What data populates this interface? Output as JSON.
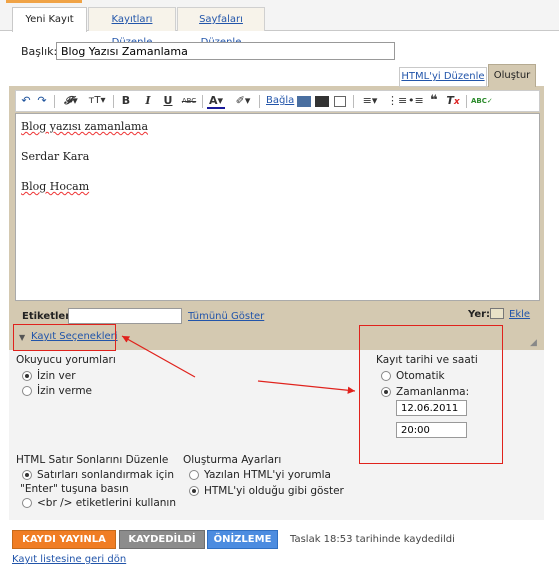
{
  "tabs": [
    "Yeni Kayıt",
    "Kayıtları Düzenle",
    "Sayfaları Düzenle"
  ],
  "title": {
    "label": "Başlık:",
    "value": "Blog Yazısı Zamanlama"
  },
  "editor_tabs": {
    "html": "HTML'yi Düzenle",
    "compose": "Oluştur"
  },
  "toolbar": {
    "link_label": "Bağla",
    "undo_icon": "undo-icon",
    "redo_icon": "redo-icon"
  },
  "body_lines": [
    "Blog yazısı zamanlama",
    "Serdar Kara",
    "Blog Hocam"
  ],
  "labels": {
    "label": "Etiketler:",
    "show_all": "Tümünü Göster"
  },
  "location": {
    "label": "Yer:",
    "add": "Ekle"
  },
  "options_link": "Kayıt Seçenekleri",
  "reader_comments": {
    "heading": "Okuyucu yorumları",
    "allow": "İzin ver",
    "deny": "İzin verme"
  },
  "post_date": {
    "heading": "Kayıt tarihi ve saati",
    "automatic": "Otomatik",
    "scheduled": "Zamanlanma:",
    "date": "12.06.2011",
    "time": "20:00"
  },
  "line_breaks": {
    "heading": "HTML Satır Sonlarını Düzenle",
    "option1_line1": "Satırları sonlandırmak için",
    "option1_line2": "\"Enter\" tuşuna basın",
    "option2": "<br /> etiketlerini kullanın"
  },
  "compose": {
    "heading": "Oluşturma Ayarları",
    "interpret": "Yazılan HTML'yi yorumla",
    "show_as_is": "HTML'yi olduğu gibi göster"
  },
  "actions": {
    "publish": "KAYDI YAYINLA",
    "saved": "KAYDEDİLDİ",
    "preview": "ÖNİZLEME",
    "status": "Taslak 18:53 tarihinde kaydedildi",
    "back": "Kayıt listesine geri dön"
  },
  "colors": {
    "accent": "#f07d24",
    "link": "#2255aa",
    "annotation": "#e0221c",
    "editor_frame": "#d4c9b1"
  }
}
